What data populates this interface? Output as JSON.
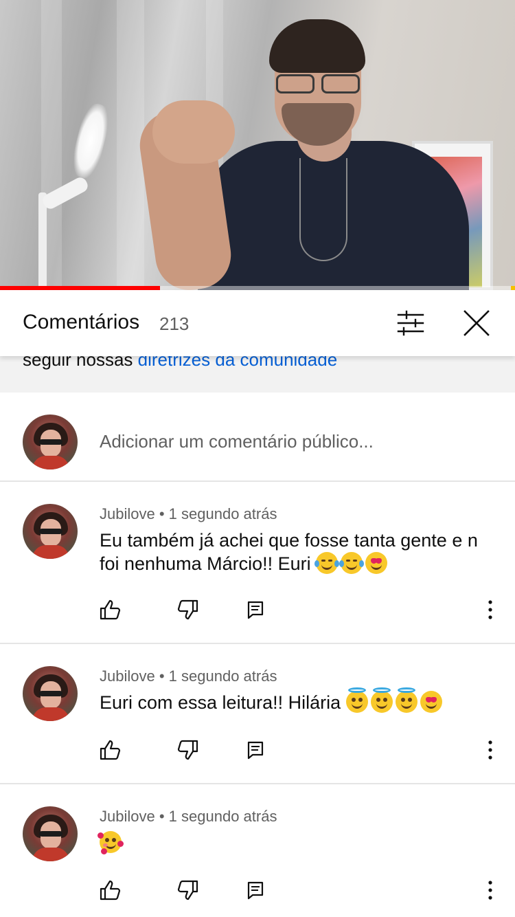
{
  "video": {
    "progress_percent": 31
  },
  "comments_header": {
    "title": "Comentários",
    "count": "213"
  },
  "guidelines": {
    "text_prefix": "seguir nossas ",
    "link_text": "diretrizes da comunidade"
  },
  "add_comment": {
    "placeholder": "Adicionar um comentário público..."
  },
  "comments": [
    {
      "author": "Jubilove",
      "separator": "•",
      "time": "1 segundo atrás",
      "text": "Eu também já achei que fosse tanta gente e n foi nenhuma Márcio!! Euri",
      "emojis": [
        "face-with-tears-of-joy",
        "face-with-tears-of-joy",
        "heart-eyes"
      ]
    },
    {
      "author": "Jubilove",
      "separator": "•",
      "time": "1 segundo atrás",
      "text": "Euri com essa leitura!! Hilária",
      "emojis": [
        "smiling-face-with-halo",
        "smiling-face-with-halo",
        "smiling-face-with-halo",
        "heart-eyes"
      ]
    },
    {
      "author": "Jubilove",
      "separator": "•",
      "time": "1 segundo atrás",
      "text": "",
      "emojis": [
        "smiling-face-with-hearts"
      ]
    }
  ],
  "icons": {
    "filter": "sliders-icon",
    "close": "close-icon",
    "like": "thumbs-up-icon",
    "dislike": "thumbs-down-icon",
    "reply": "reply-icon",
    "more": "more-vertical-icon"
  },
  "colors": {
    "link": "#065fd4",
    "progress": "#ff0000",
    "secondary_text": "#606060"
  }
}
